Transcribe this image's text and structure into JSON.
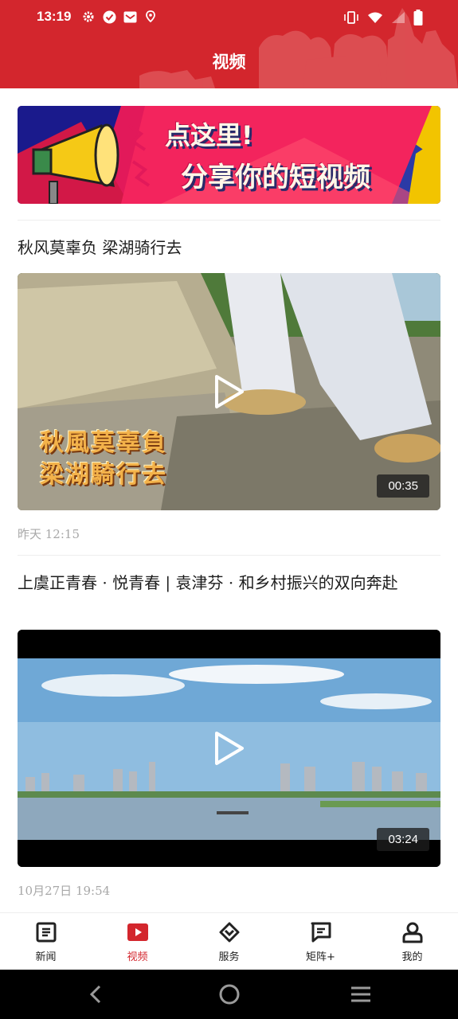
{
  "status_bar": {
    "time": "13:19",
    "left_icons": [
      "gear-icon",
      "check-circle-icon",
      "mail-icon",
      "location-icon"
    ],
    "right_icons": [
      "vibrate-icon",
      "wifi-icon",
      "signal-icon",
      "battery-icon"
    ]
  },
  "header": {
    "title": "视频"
  },
  "banner": {
    "line1": "点这里!",
    "line2": "分享你的短视频"
  },
  "feed": [
    {
      "title": "秋风莫辜负  梁湖骑行去",
      "overlay_line1": "秋風莫辜負",
      "overlay_line2": "梁湖騎行去",
      "duration": "00:35",
      "meta": "昨天  12:15"
    },
    {
      "title": "上虞正青春 · 悦青春  |  袁津芬 · 和乡村振兴的双向奔赴",
      "duration": "03:24",
      "meta": "10月27日  19:54"
    }
  ],
  "tabs": [
    {
      "label": "新闻",
      "icon": "news-icon",
      "active": false
    },
    {
      "label": "视频",
      "icon": "video-play-icon",
      "active": true
    },
    {
      "label": "服务",
      "icon": "service-diamond-icon",
      "active": false
    },
    {
      "label": "矩阵+",
      "icon": "chat-matrix-icon",
      "active": false
    },
    {
      "label": "我的",
      "icon": "user-icon",
      "active": false
    }
  ],
  "colors": {
    "brand_red": "#d3262d",
    "meta_gray": "#a8a8a8"
  }
}
